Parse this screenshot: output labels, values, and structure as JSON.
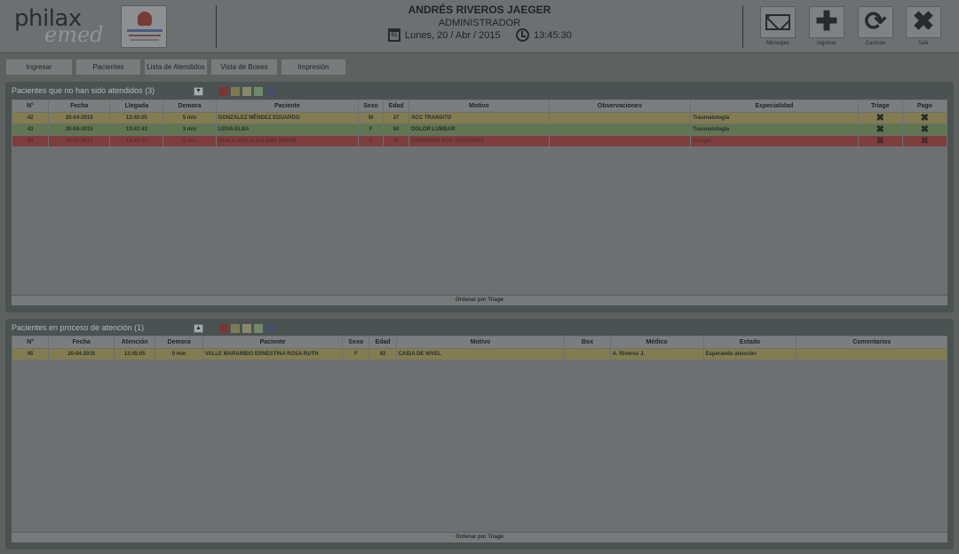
{
  "header": {
    "logo": {
      "part1": "philax",
      "part2": "emed"
    },
    "user_name": "ANDRÉS RIVEROS JAEGER",
    "user_role": "ADMINISTRADOR",
    "date_icon_text": "01",
    "date": "Lunes, 20 / Abr / 2015",
    "time": "13:45:30",
    "buttons": [
      {
        "icon": "envelope-icon",
        "label": "Mensajes"
      },
      {
        "icon": "plus-icon",
        "label": "Ingresar"
      },
      {
        "icon": "refresh-icon",
        "label": "Cambiar"
      },
      {
        "icon": "close-icon",
        "label": "Salir"
      }
    ]
  },
  "nav": [
    "Ingresar",
    "Pacientes",
    "Lista de Atendidos",
    "Vista de Boxes",
    "Impresión"
  ],
  "panel1": {
    "title": "Pacientes que no han sido atendidos (3)",
    "toggle_icon": "chevron-down-icon",
    "legend_colors": [
      "#7c3434",
      "#7e7a52",
      "#878a6a",
      "#6f8a6a",
      "#44506a"
    ],
    "columns": [
      "N°",
      "Fecha",
      "Llegada",
      "Demora",
      "Paciente",
      "Sexo",
      "Edad",
      "Motivo",
      "Observaciones",
      "Especialidad",
      "Triage",
      "Pago"
    ],
    "rows": [
      {
        "n": "42",
        "fecha": "20-04-2015",
        "llegada": "13:40:05",
        "demora": "5 min",
        "paciente": "GONZÁLEZ MÉNDEZ EDUARDO",
        "sexo": "M",
        "edad": "27",
        "motivo": "ACC TRANSITO",
        "obs": "",
        "especialidad": "Traumatología",
        "triage": "✖",
        "pago": "✖"
      },
      {
        "n": "43",
        "fecha": "20-04-2015",
        "llegada": "13:41:43",
        "demora": "3 min",
        "paciente": "LEIVA ELBA",
        "sexo": "F",
        "edad": "84",
        "motivo": "DOLOR LUMBAR",
        "obs": "",
        "especialidad": "Traumatología",
        "triage": "✖",
        "pago": "✖"
      },
      {
        "n": "44",
        "fecha": "20-04-2015",
        "llegada": "13:43:17",
        "demora": "2 min",
        "paciente": "AYALA AYALA ZULEMA NOEMÍ",
        "sexo": "F",
        "edad": "85",
        "motivo": "AGRESION POR TERCEROS",
        "obs": "",
        "especialidad": "Cirugía",
        "triage": "✖",
        "pago": "✖"
      }
    ],
    "footer": "Ordenar por Triage"
  },
  "panel2": {
    "title": "Pacientes en proceso de atención (1)",
    "toggle_icon": "chevron-up-icon",
    "legend_colors": [
      "#7c3434",
      "#7e7a52",
      "#878a6a",
      "#6f8a6a",
      "#44506a"
    ],
    "columns": [
      "N°",
      "Fecha",
      "Atención",
      "Demora",
      "Paciente",
      "Sexo",
      "Edad",
      "Motivo",
      "Box",
      "Médico",
      "Estado",
      "Comentarios"
    ],
    "rows": [
      {
        "n": "45",
        "fecha": "20-04-2015",
        "atencion": "13:45:05",
        "demora": "0 min",
        "paciente": "VALLE MARAMBIO ERNESTINA ROSA RUTH",
        "sexo": "F",
        "edad": "92",
        "motivo": "CAIDA DE NIVEL",
        "box": "",
        "medico": "A. Riveros J.",
        "estado": "Esperando atención",
        "comentarios": ""
      }
    ],
    "footer": "Ordenar por Triage"
  }
}
